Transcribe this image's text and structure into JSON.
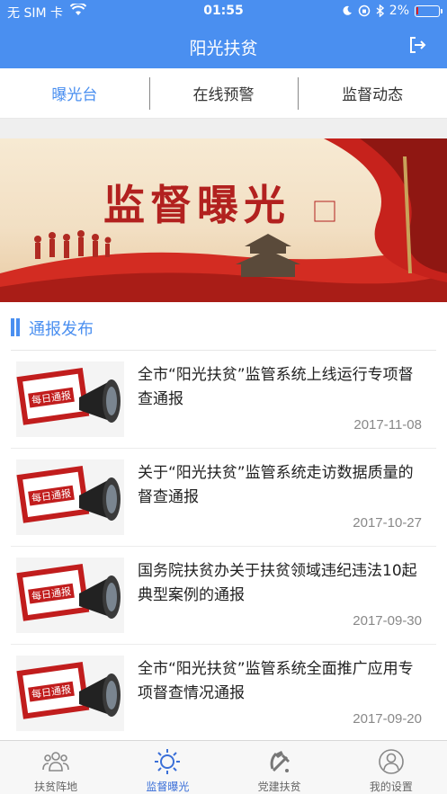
{
  "status": {
    "carrier": "无 SIM 卡",
    "time": "01:55",
    "battery": "2%",
    "battery_level": 0.02
  },
  "header": {
    "title": "阳光扶贫"
  },
  "tabs": [
    {
      "label": "曝光台",
      "active": true
    },
    {
      "label": "在线预警",
      "active": false
    },
    {
      "label": "监督动态",
      "active": false
    }
  ],
  "banner": {
    "title": "监督曝光"
  },
  "section": {
    "title": "通报发布"
  },
  "news": [
    {
      "thumb_text": "每日通报",
      "title": "全市“阳光扶贫”监管系统上线运行专项督查通报",
      "date": "2017-11-08"
    },
    {
      "thumb_text": "每日通报",
      "title": "关于“阳光扶贫”监管系统走访数据质量的督查通报",
      "date": "2017-10-27"
    },
    {
      "thumb_text": "每日通报",
      "title": "国务院扶贫办关于扶贫领域违纪违法10起典型案例的通报",
      "date": "2017-09-30"
    },
    {
      "thumb_text": "每日通报",
      "title": "全市“阳光扶贫”监管系统全面推广应用专项督查情况通报",
      "date": "2017-09-20"
    }
  ],
  "tabbar": [
    {
      "label": "扶贫阵地",
      "icon": "people-icon",
      "active": false
    },
    {
      "label": "监督曝光",
      "icon": "sun-icon",
      "active": true
    },
    {
      "label": "党建扶贫",
      "icon": "party-emblem-icon",
      "active": false
    },
    {
      "label": "我的设置",
      "icon": "user-icon",
      "active": false
    }
  ],
  "colors": {
    "accent": "#4a8ff0",
    "banner_red": "#b2211f"
  }
}
